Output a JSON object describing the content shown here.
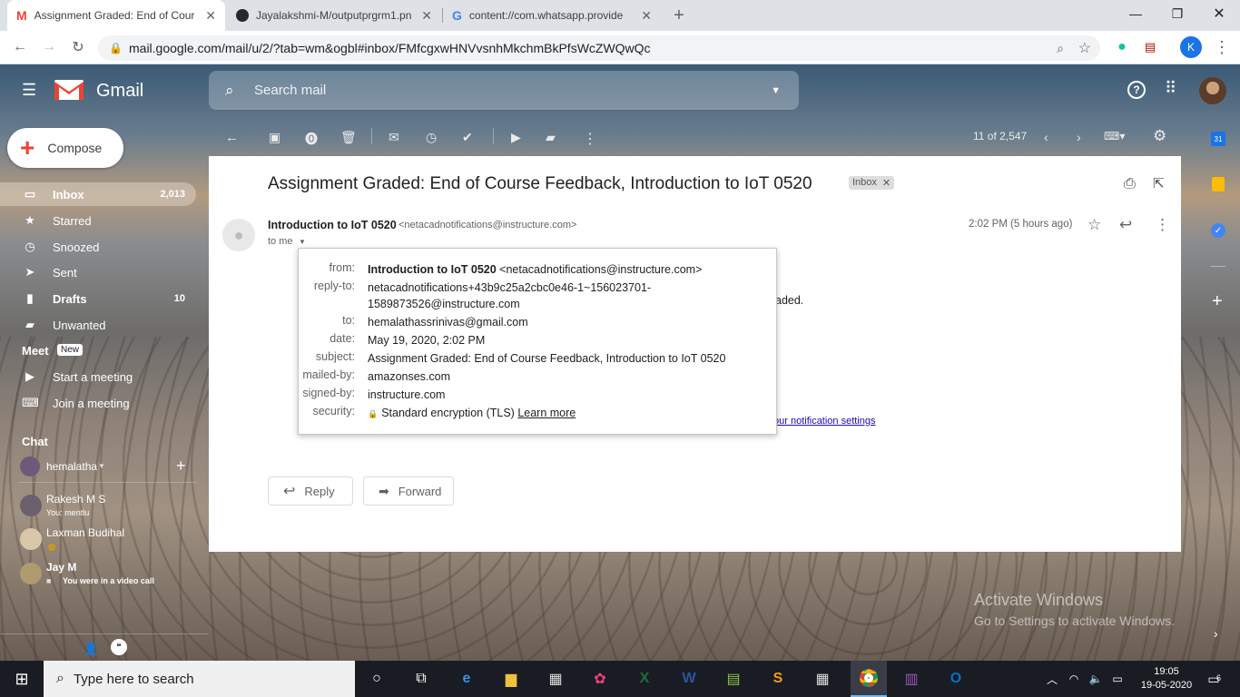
{
  "browser": {
    "tabs": [
      {
        "title": "Assignment Graded: End of Cour",
        "icon": "gmail-icon",
        "active": true
      },
      {
        "title": "Jayalakshmi-M/outputprgrm1.pn",
        "icon": "github-icon",
        "active": false
      },
      {
        "title": "content://com.whatsapp.provide",
        "icon": "google-icon",
        "active": false
      }
    ],
    "new_tab": "+",
    "url": "mail.google.com/mail/u/2/?tab=wm&ogbl#inbox/FMfcgxwHNVvsnhMkchmBkPfsWcZWQwQc",
    "profile_initial": "K"
  },
  "gmail": {
    "logo_text": "Gmail",
    "search_placeholder": "Search mail",
    "compose_label": "Compose",
    "nav": [
      {
        "label": "Inbox",
        "count": "2,013",
        "icon": "inbox-icon",
        "selected": true
      },
      {
        "label": "Starred",
        "count": "",
        "icon": "star-icon"
      },
      {
        "label": "Snoozed",
        "count": "",
        "icon": "clock-icon"
      },
      {
        "label": "Sent",
        "count": "",
        "icon": "send-icon"
      },
      {
        "label": "Drafts",
        "count": "10",
        "icon": "draft-icon"
      },
      {
        "label": "Unwanted",
        "count": "",
        "icon": "label-icon"
      }
    ],
    "meet": {
      "heading": "Meet",
      "badge": "New",
      "items": [
        {
          "label": "Start a meeting",
          "icon": "video-icon"
        },
        {
          "label": "Join a meeting",
          "icon": "keyboard-icon"
        }
      ]
    },
    "chat": {
      "heading": "Chat",
      "self": "hemalatha",
      "contacts": [
        {
          "name": "Rakesh M S",
          "status": "You: mentlu"
        },
        {
          "name": "Laxman Budihal",
          "status": ""
        },
        {
          "name": "Jay M",
          "status": "You were in a video call"
        }
      ]
    },
    "pagination": "11 of 2,547",
    "message": {
      "subject": "Assignment Graded: End of Course Feedback, Introduction to IoT 0520",
      "label": "Inbox",
      "sender_name": "Introduction to IoT 0520",
      "sender_email": "<netacadnotifications@instructure.com>",
      "to_line": "to me",
      "time": "2:02 PM (5 hours ago)",
      "body_fragment": "aded.",
      "link_fragment": "our notification settings"
    },
    "details": {
      "from_label": "from:",
      "from_name": "Introduction to IoT 0520",
      "from_email": "<netacadnotifications@instructure.com>",
      "replyto_label": "reply-to:",
      "replyto_line1": "netacadnotifications+43b9c25a2cbc0e46-1~156023701-",
      "replyto_line2": "1589873526@instructure.com",
      "to_label": "to:",
      "to_value": "hemalathassrinivas@gmail.com",
      "date_label": "date:",
      "date_value": "May 19, 2020, 2:02 PM",
      "subject_label": "subject:",
      "subject_value": "Assignment Graded: End of Course Feedback, Introduction to IoT 0520",
      "mailedby_label": "mailed-by:",
      "mailedby_value": "amazonses.com",
      "signedby_label": "signed-by:",
      "signedby_value": "instructure.com",
      "security_label": "security:",
      "security_value": "Standard encryption (TLS)",
      "learn_more": "Learn more"
    },
    "reply_label": "Reply",
    "forward_label": "Forward",
    "watermark_line1": "Activate Windows",
    "watermark_line2": "Go to Settings to activate Windows."
  },
  "taskbar": {
    "search_placeholder": "Type here to search",
    "time": "19:05",
    "date": "19-05-2020",
    "notifications": "6"
  },
  "colors": {
    "gmail_red": "#ea4335",
    "link_blue": "#1a0dab",
    "taskbar_bg": "#1a1c24"
  }
}
